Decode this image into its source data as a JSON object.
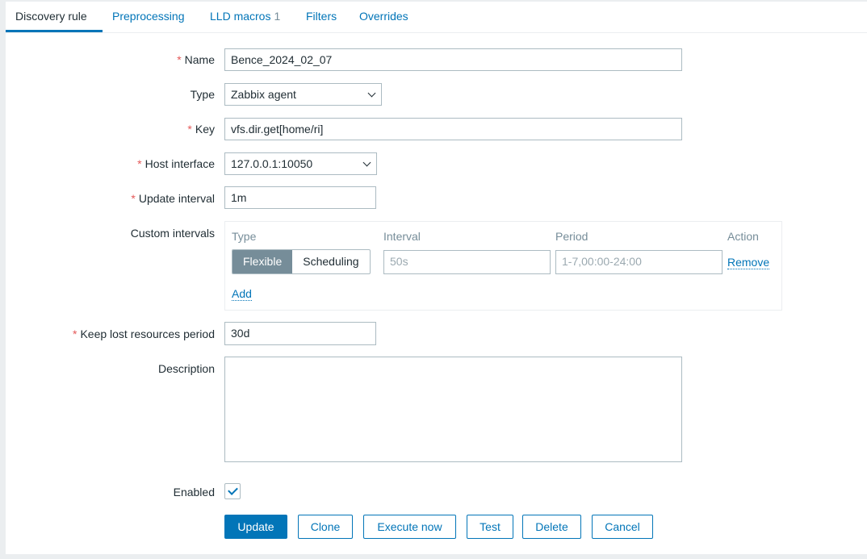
{
  "tabs": [
    {
      "label": "Discovery rule"
    },
    {
      "label": "Preprocessing"
    },
    {
      "label": "LLD macros",
      "badge": "1"
    },
    {
      "label": "Filters"
    },
    {
      "label": "Overrides"
    }
  ],
  "form": {
    "name": {
      "label": "Name",
      "value": "Bence_2024_02_07"
    },
    "type": {
      "label": "Type",
      "value": "Zabbix agent"
    },
    "key": {
      "label": "Key",
      "value": "vfs.dir.get[home/ri]"
    },
    "host_interface": {
      "label": "Host interface",
      "value": "127.0.0.1:10050"
    },
    "update_interval": {
      "label": "Update interval",
      "value": "1m"
    },
    "custom_intervals": {
      "label": "Custom intervals",
      "headers": [
        "Type",
        "Interval",
        "Period",
        "Action"
      ],
      "type_options": [
        "Flexible",
        "Scheduling"
      ],
      "selected_type": "Flexible",
      "interval_placeholder": "50s",
      "period_placeholder": "1-7,00:00-24:00",
      "remove": "Remove",
      "add": "Add"
    },
    "keep_lost": {
      "label": "Keep lost resources period",
      "value": "30d"
    },
    "description": {
      "label": "Description",
      "value": ""
    },
    "enabled": {
      "label": "Enabled",
      "checked": true
    }
  },
  "buttons": {
    "update": "Update",
    "clone": "Clone",
    "execute": "Execute now",
    "test": "Test",
    "delete": "Delete",
    "cancel": "Cancel"
  },
  "colors": {
    "accent": "#0275b8",
    "required": "#e45959"
  }
}
